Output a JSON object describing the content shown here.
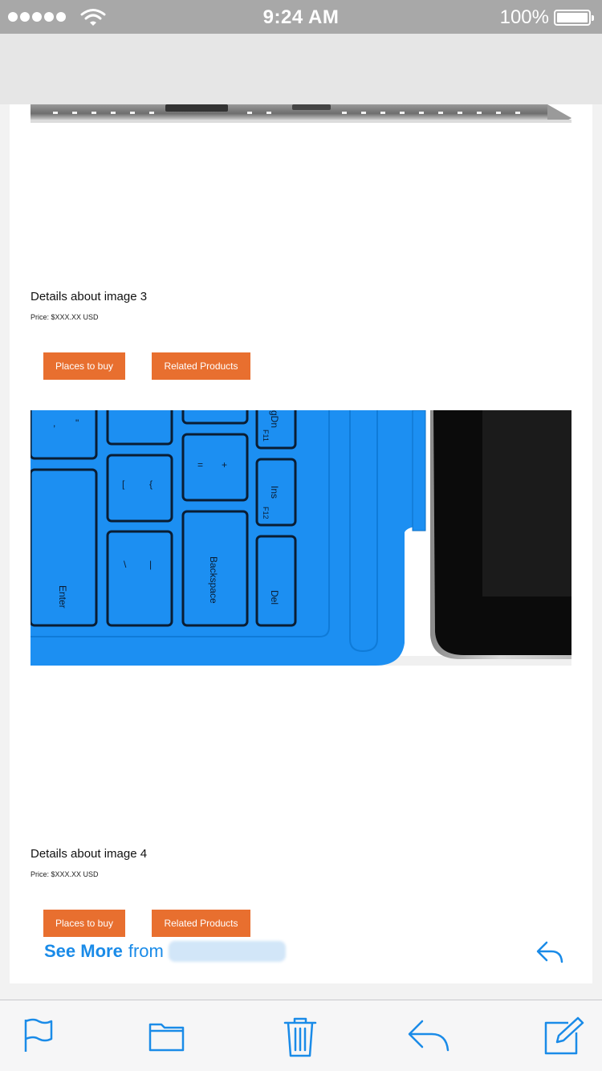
{
  "status_bar": {
    "time": "9:24 AM",
    "battery_percent": "100%",
    "battery_level": 1.0,
    "signal_bars": 5,
    "wifi_icon": "wifi-icon"
  },
  "products": [
    {
      "details": "Details about image 3",
      "price": "Price: $XXX.XX USD",
      "places_label": "Places to buy",
      "related_label": "Related Products"
    },
    {
      "details": "Details about image 4",
      "price": "Price: $XXX.XX USD",
      "places_label": "Places to buy",
      "related_label": "Related Products"
    }
  ],
  "keyboard_keys": [
    "Enter",
    "Backspace",
    "Ins",
    "Del",
    "F11",
    "F12",
    "gDn"
  ],
  "see_more": {
    "label": "See More",
    "from": "from"
  },
  "toolbar": {
    "icons": [
      "flag-icon",
      "folder-icon",
      "trash-icon",
      "reply-icon",
      "compose-icon"
    ]
  },
  "colors": {
    "accent": "#1a8be8",
    "button": "#e86f2f",
    "keyboard_blue": "#1c8ff2",
    "status_bar": "#a8a8a8"
  }
}
